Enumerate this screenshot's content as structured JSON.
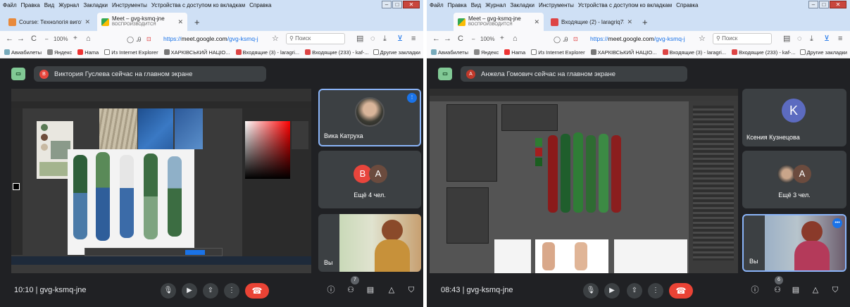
{
  "left": {
    "menu": [
      "Файл",
      "Правка",
      "Вид",
      "Журнал",
      "Закладки",
      "Инструменты",
      "Устройства с доступом ко вкладкам",
      "Справка"
    ],
    "tabs": [
      {
        "label": "Course: Технологія виготовле",
        "sub": ""
      },
      {
        "label": "Meet – gvg-ksmq-jne",
        "sub": "ВОСПРОИЗВОДИТСЯ"
      }
    ],
    "zoom": "100%",
    "url_prefix": "https://",
    "url_domain": "meet.google.com",
    "url_path": "/gvg-ksmq-j",
    "search_placeholder": "Поиск",
    "bookmarks": [
      "Авиабилеты",
      "Яндекс",
      "Hama",
      "Из Internet Explorer",
      "ХАРКІВСЬКИЙ НАЦІО...",
      "Входящие (3) - laragri...",
      "Входящие (233) - kaf-..."
    ],
    "other_bookmarks": "Другие закладки",
    "presenter_initial": "В",
    "presenter_text": "Виктория Гуслева сейчас на главном экране",
    "tiles": {
      "camera_name": "Вика Катруха",
      "more_label": "Ещё 4 чел.",
      "more_initials": [
        "В",
        "А"
      ],
      "you": "Вы"
    },
    "time": "10:10",
    "code": "gvg-ksmq-jne",
    "participants": "7"
  },
  "right": {
    "menu": [
      "Файл",
      "Правка",
      "Вид",
      "Журнал",
      "Закладки",
      "Инструменты",
      "Устройства с доступом ко вкладкам",
      "Справка"
    ],
    "tabs": [
      {
        "label": "Meet – gvg-ksmq-jne",
        "sub": "ВОСПРОИЗВОДИТСЯ"
      },
      {
        "label": "Входящие (2) - laragriq73@gm",
        "sub": ""
      }
    ],
    "zoom": "100%",
    "url_prefix": "https://",
    "url_domain": "meet.google.com",
    "url_path": "/gvg-ksmq-j",
    "search_placeholder": "Поиск",
    "bookmarks": [
      "Авиабилеты",
      "Яндекс",
      "Hama",
      "Из Internet Explorer",
      "ХАРКІВСЬКИЙ НАЦІО...",
      "Входящие (3) - laragri...",
      "Входящие (233) - kaf-..."
    ],
    "other_bookmarks": "Другие закладки",
    "presenter_initial": "А",
    "presenter_text": "Анжела Гомович сейчас на главном экране",
    "tiles": {
      "k_initial": "K",
      "k_name": "Ксения Кузнецова",
      "more_label": "Ещё 3 чел.",
      "more_initials": [
        "А"
      ],
      "you": "Вы"
    },
    "time": "08:43",
    "code": "gvg-ksmq-jne",
    "participants": "6"
  },
  "colors": {
    "meet_bg": "#202124",
    "tile_bg": "#3c4043",
    "accent": "#8ab4f8",
    "hangup": "#ea4335",
    "present_green": "#81c995"
  }
}
